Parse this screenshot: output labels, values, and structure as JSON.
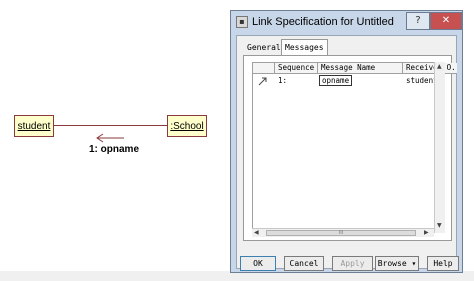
{
  "diagram": {
    "object_left": "student",
    "object_right": ":School",
    "message_label": "1: opname"
  },
  "dialog": {
    "title": "Link Specification for Untitled",
    "help_glyph": "?",
    "close_glyph": "✕",
    "tabs": [
      "General",
      "Messages"
    ],
    "active_tab": "Messages",
    "table": {
      "columns": [
        "",
        "Sequence",
        "Message Name",
        "Receiver O..."
      ],
      "rows": [
        {
          "sequence": "1:",
          "message_name": "opname",
          "receiver": "student"
        }
      ]
    },
    "buttons": {
      "ok": "OK",
      "cancel": "Cancel",
      "apply": "Apply",
      "browse": "Browse ▾",
      "help": "Help"
    },
    "scroll_glyph": "III"
  },
  "colors": {
    "uml_fill": "#ffffcc",
    "uml_border": "#8a3a3a",
    "dialog_frame": "#c7d6e8",
    "close_button": "#c75050"
  },
  "icons": [
    "message-arrow-icon",
    "app-icon",
    "help-icon",
    "close-icon",
    "message-row-icon"
  ]
}
